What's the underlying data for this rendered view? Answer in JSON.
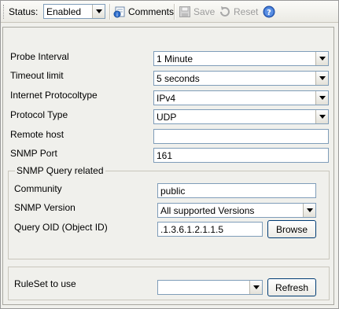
{
  "toolbar": {
    "status_label": "Status:",
    "status_value": "Enabled",
    "comments_label": "Comments",
    "save_label": "Save",
    "reset_label": "Reset"
  },
  "form": {
    "probe_interval": {
      "label": "Probe Interval",
      "value": "1 Minute"
    },
    "timeout_limit": {
      "label": "Timeout limit",
      "value": "5 seconds"
    },
    "internet_protocol": {
      "label": "Internet Protocoltype",
      "value": "IPv4"
    },
    "protocol_type": {
      "label": "Protocol Type",
      "value": "UDP"
    },
    "remote_host": {
      "label": "Remote host",
      "value": ""
    },
    "snmp_port": {
      "label": "SNMP Port",
      "value": "161"
    }
  },
  "snmp_group": {
    "title": "SNMP Query related",
    "community": {
      "label": "Community",
      "value": "public"
    },
    "snmp_version": {
      "label": "SNMP Version",
      "value": "All supported Versions"
    },
    "query_oid": {
      "label": "Query OID (Object ID)",
      "value": ".1.3.6.1.2.1.1.5"
    },
    "browse_label": "Browse"
  },
  "ruleset": {
    "label": "RuleSet to use",
    "value": "",
    "refresh_label": "Refresh"
  }
}
